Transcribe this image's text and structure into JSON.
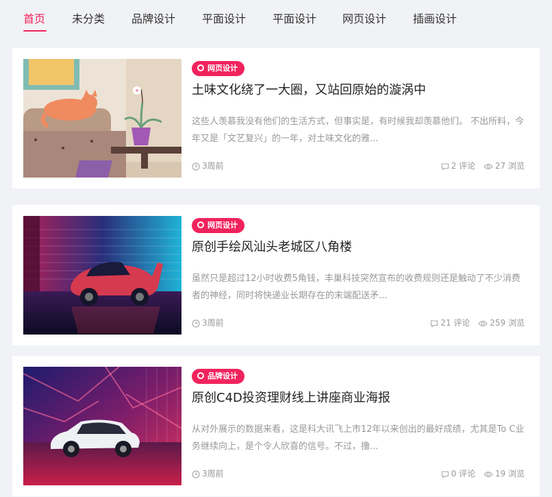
{
  "nav": {
    "tabs": [
      {
        "label": "首页",
        "active": true
      },
      {
        "label": "未分类"
      },
      {
        "label": "品牌设计"
      },
      {
        "label": "平面设计"
      },
      {
        "label": "平面设计"
      },
      {
        "label": "网页设计"
      },
      {
        "label": "插画设计"
      }
    ]
  },
  "colors": {
    "accent": "#f1235d",
    "background": "#f1f2f5"
  },
  "posts": [
    {
      "category": "网页设计",
      "title": "土味文化绕了一大圈，又站回原始的漩涡中",
      "excerpt": "这些人羡慕我没有他们的生活方式，但事实是，有时候我却羡慕他们。 不出所料，今年又是「文艺复兴」的一年，对土味文化的雅...",
      "time": "3周前",
      "comments": "2 评论",
      "views": "27 浏览"
    },
    {
      "category": "网页设计",
      "title": "原创手绘风汕头老城区八角楼",
      "excerpt": "虽然只是超过12小时收费5角钱，丰巢科技突然宣布的收费规则还是触动了不少消费者的神经，同时将快递业长期存在的末端配送矛...",
      "time": "3周前",
      "comments": "21 评论",
      "views": "259 浏览"
    },
    {
      "category": "品牌设计",
      "title": "原创C4D投资理财线上讲座商业海报",
      "excerpt": "从对外展示的数据来看，这是科大讯飞上市12年以来创出的最好成绩，尤其是To C业务继续向上，是个令人欣喜的信号。不过，撸...",
      "time": "3周前",
      "comments": "0 评论",
      "views": "19 浏览"
    }
  ]
}
